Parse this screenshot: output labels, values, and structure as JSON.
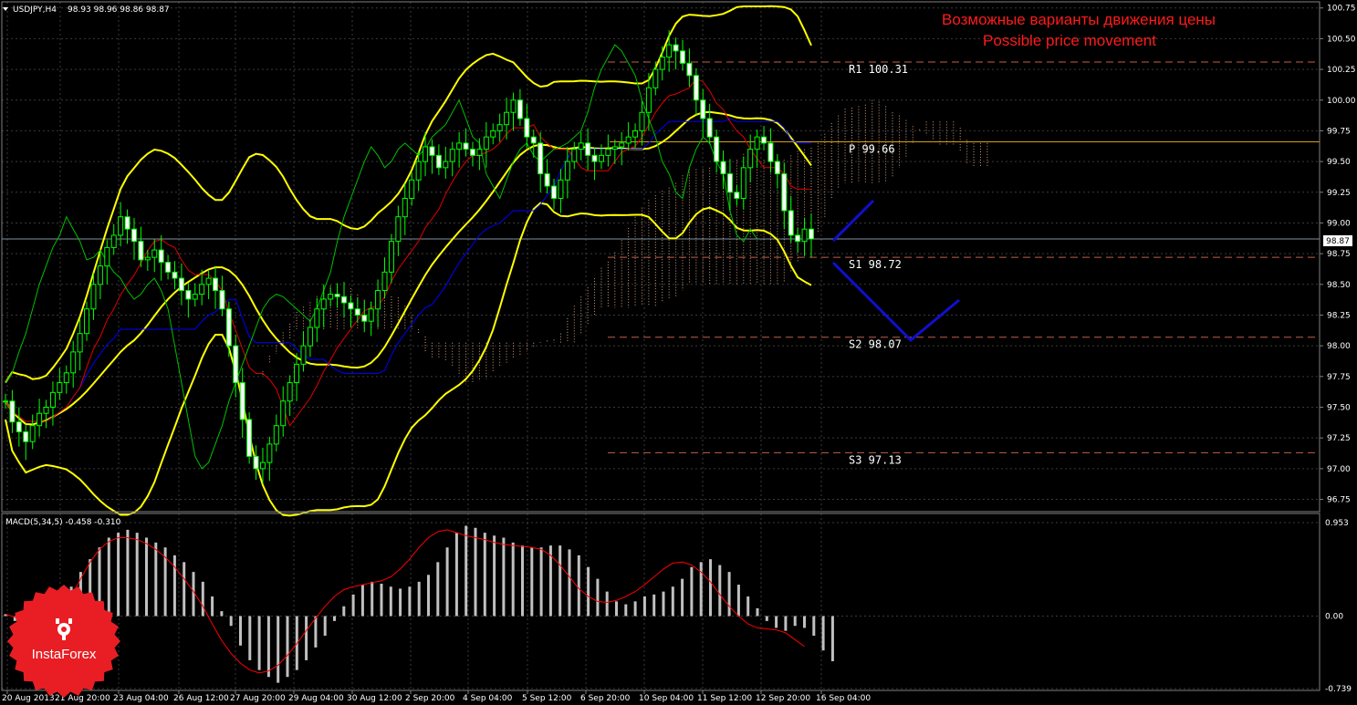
{
  "window": {
    "symbol_label": "USDJPY,H4",
    "ohlc_label": "98.93 98.96 98.86 98.87",
    "current_price": "98.87"
  },
  "annotation": {
    "line1": "Возможные варианты движения цены",
    "line2": "Possible price movement",
    "color": "#ff1a1a"
  },
  "logo": {
    "text": "InstaForex",
    "color": "#e81e24"
  },
  "colors": {
    "candle_up": "#00ff00",
    "bollinger": "#ffff00",
    "tenkan": "#e00000",
    "kijun": "#0000ff",
    "chikou": "#00c000",
    "cloud": "#d9a07a",
    "pivot": "#d4a017",
    "levels": "#c0604a",
    "forecast": "#1010d0",
    "macd_hist": "#c0c0c0",
    "macd_signal": "#ff0000",
    "axis": "#808080"
  },
  "chart_data": [
    {
      "type": "candlestick",
      "title": "USDJPY,H4",
      "y_axis_ticks": [
        "100.75",
        "100.50",
        "100.25",
        "100.00",
        "99.75",
        "99.50",
        "99.25",
        "99.00",
        "98.75",
        "98.50",
        "98.25",
        "98.00",
        "97.75",
        "97.50",
        "97.25",
        "97.00",
        "96.75"
      ],
      "ylim": [
        96.65,
        100.8
      ],
      "x_axis_ticks": [
        "20 Aug 2013",
        "21 Aug 20:00",
        "23 Aug 04:00",
        "26 Aug 12:00",
        "27 Aug 20:00",
        "29 Aug 04:00",
        "30 Aug 12:00",
        "2 Sep 20:00",
        "4 Sep 04:00",
        "5 Sep 12:00",
        "6 Sep 20:00",
        "10 Sep 04:00",
        "11 Sep 12:00",
        "12 Sep 20:00",
        "16 Sep 04:00"
      ],
      "indicators": [
        "Bollinger Bands",
        "Ichimoku Kinko Hyo"
      ],
      "levels": [
        {
          "label": "R1 100.31",
          "value": 100.31
        },
        {
          "label": "P 99.66",
          "value": 99.66
        },
        {
          "label": "S1 98.72",
          "value": 98.72
        },
        {
          "label": "S2 98.07",
          "value": 98.07
        },
        {
          "label": "S3 97.13",
          "value": 97.13
        }
      ],
      "series": [
        {
          "name": "USDJPY",
          "close": [
            97.55,
            97.38,
            97.3,
            97.22,
            97.35,
            97.45,
            97.5,
            97.62,
            97.7,
            97.78,
            97.95,
            98.1,
            98.3,
            98.5,
            98.65,
            98.8,
            98.9,
            99.05,
            98.95,
            98.85,
            98.7,
            98.72,
            98.78,
            98.68,
            98.6,
            98.55,
            98.45,
            98.38,
            98.42,
            98.5,
            98.55,
            98.45,
            98.3,
            98.0,
            97.7,
            97.4,
            97.1,
            97.0,
            97.05,
            97.2,
            97.35,
            97.55,
            97.7,
            97.85,
            98.0,
            98.15,
            98.3,
            98.38,
            98.42,
            98.4,
            98.35,
            98.3,
            98.25,
            98.2,
            98.3,
            98.45,
            98.6,
            98.85,
            99.05,
            99.2,
            99.35,
            99.5,
            99.62,
            99.55,
            99.45,
            99.5,
            99.6,
            99.65,
            99.6,
            99.55,
            99.6,
            99.7,
            99.75,
            99.8,
            99.9,
            100.0,
            99.85,
            99.7,
            99.65,
            99.4,
            99.3,
            99.2,
            99.35,
            99.5,
            99.6,
            99.65,
            99.55,
            99.5,
            99.55,
            99.6,
            99.62,
            99.65,
            99.7,
            99.75,
            99.9,
            100.1,
            100.25,
            100.35,
            100.45,
            100.4,
            100.3,
            100.2,
            100.0,
            99.85,
            99.7,
            99.5,
            99.4,
            99.25,
            99.2,
            99.45,
            99.6,
            99.7,
            99.65,
            99.5,
            99.4,
            99.1,
            98.9,
            98.85,
            98.95,
            98.87
          ]
        }
      ]
    },
    {
      "type": "bar",
      "title": "MACD(5,34,5) -0.458 -0.310",
      "y_axis_ticks": [
        "0.953",
        "0.00",
        "-0.739"
      ],
      "ylim": [
        -0.739,
        0.953
      ],
      "series": [
        {
          "name": "MACD histogram",
          "values": [
            0.02,
            -0.05,
            -0.12,
            -0.15,
            -0.1,
            0.0,
            0.15,
            0.3,
            0.45,
            0.58,
            0.7,
            0.8,
            0.85,
            0.88,
            0.85,
            0.8,
            0.75,
            0.7,
            0.62,
            0.55,
            0.45,
            0.35,
            0.2,
            0.05,
            -0.1,
            -0.3,
            -0.45,
            -0.55,
            -0.62,
            -0.68,
            -0.62,
            -0.55,
            -0.45,
            -0.32,
            -0.2,
            -0.05,
            0.1,
            0.22,
            0.32,
            0.35,
            0.33,
            0.3,
            0.28,
            0.3,
            0.35,
            0.42,
            0.55,
            0.7,
            0.85,
            0.92,
            0.9,
            0.85,
            0.82,
            0.8,
            0.75,
            0.72,
            0.7,
            0.7,
            0.72,
            0.72,
            0.68,
            0.62,
            0.5,
            0.38,
            0.25,
            0.15,
            0.12,
            0.15,
            0.2,
            0.22,
            0.25,
            0.3,
            0.38,
            0.5,
            0.55,
            0.58,
            0.52,
            0.45,
            0.32,
            0.2,
            0.08,
            -0.05,
            -0.12,
            -0.15,
            -0.1,
            -0.12,
            -0.2,
            -0.35,
            -0.46
          ]
        },
        {
          "name": "Signal",
          "values": [
            0.02,
            -0.01,
            -0.05,
            -0.08,
            -0.08,
            -0.05,
            0.05,
            0.2,
            0.38,
            0.55,
            0.68,
            0.76,
            0.8,
            0.8,
            0.78,
            0.74,
            0.68,
            0.6,
            0.5,
            0.38,
            0.25,
            0.1,
            -0.08,
            -0.25,
            -0.38,
            -0.48,
            -0.55,
            -0.58,
            -0.56,
            -0.5,
            -0.4,
            -0.28,
            -0.15,
            -0.02,
            0.1,
            0.2,
            0.27,
            0.3,
            0.32,
            0.34,
            0.36,
            0.4,
            0.48,
            0.58,
            0.7,
            0.8,
            0.86,
            0.88,
            0.85,
            0.82,
            0.8,
            0.78,
            0.75,
            0.73,
            0.72,
            0.71,
            0.7,
            0.68,
            0.62,
            0.52,
            0.4,
            0.28,
            0.2,
            0.15,
            0.14,
            0.16,
            0.2,
            0.25,
            0.32,
            0.4,
            0.48,
            0.54,
            0.55,
            0.52,
            0.45,
            0.35,
            0.22,
            0.1,
            0.0,
            -0.08,
            -0.12,
            -0.13,
            -0.14,
            -0.17,
            -0.24,
            -0.31
          ]
        }
      ]
    }
  ]
}
